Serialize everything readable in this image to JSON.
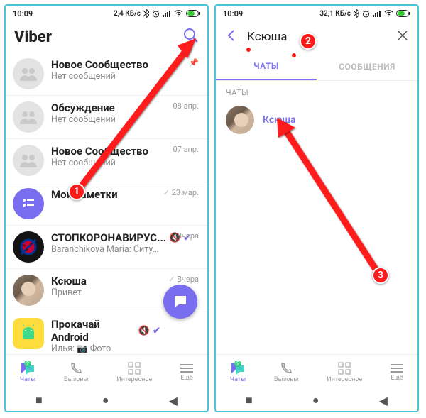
{
  "left": {
    "status": {
      "time": "10:09",
      "net": "2,4 КБ/с"
    },
    "title": "Viber",
    "chats": [
      {
        "name": "Новое Сообщество",
        "preview": "Нет сообщений",
        "meta": "",
        "pinned": true
      },
      {
        "name": "Обсуждение",
        "preview": "Нет сообщений",
        "meta": "08 апр."
      },
      {
        "name": "Новое Сообщество",
        "preview": "Нет сообщений",
        "meta": "07 апр."
      },
      {
        "name": "Мои заметки",
        "preview": "",
        "meta": "23 мар.",
        "sent": true
      },
      {
        "name": "СТОПКОРОНАВИРУС...",
        "preview": "Baranchikova Maria: Ситуация с распространением коронав...",
        "meta": "Вчера",
        "muted": true,
        "verified": true
      },
      {
        "name": "Ксюша",
        "preview": "Привет",
        "meta": "Вчера",
        "sent": true
      },
      {
        "name": "Прокачай Android",
        "preview": "Илья: 📷 Фото",
        "meta": "",
        "muted": true,
        "verified": true
      }
    ],
    "nav": {
      "chats": "Чаты",
      "calls": "Вызовы",
      "explore": "Интересное",
      "more": "Ещё",
      "badge": "2"
    }
  },
  "right": {
    "status": {
      "time": "10:09",
      "net": "32,1 КБ/с"
    },
    "search_value": "Ксюша",
    "tabs": {
      "chats": "ЧАТЫ",
      "messages": "СООБЩЕНИЯ"
    },
    "section": "ЧАТЫ",
    "result": "Ксюша",
    "nav": {
      "chats": "Чаты",
      "calls": "Вызовы",
      "explore": "Интересное",
      "more": "Ещё",
      "badge": "2"
    }
  },
  "steps": {
    "s1": "1",
    "s2": "2",
    "s3": "3"
  }
}
